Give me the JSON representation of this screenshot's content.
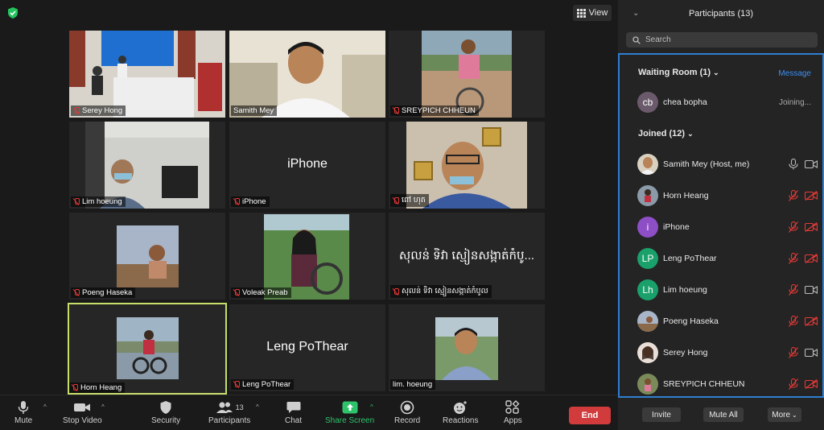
{
  "view_label": "View",
  "tiles": [
    {
      "name": "Serey Hong",
      "muted": true
    },
    {
      "name": "Samith Mey",
      "muted": false
    },
    {
      "name": "SREYPICH CHHEUN",
      "muted": true
    },
    {
      "name": "Lim hoeung",
      "muted": true
    },
    {
      "name": "iPhone",
      "muted": true,
      "big": "iPhone"
    },
    {
      "name": "ពៅ ហុត",
      "muted": true
    },
    {
      "name": "Poeng Haseka",
      "muted": true
    },
    {
      "name": "Voleak Preab",
      "muted": true
    },
    {
      "name": "សុលន់ ទិវា ស្មៀនសង្កាត់កំបូល",
      "muted": true,
      "big": "សុលន់ ទិវា ស្មៀនសង្កាត់កំបូ..."
    },
    {
      "name": "Horn Heang",
      "muted": true
    },
    {
      "name": "Leng PoThear",
      "muted": true,
      "big": "Leng PoThear"
    },
    {
      "name": "lim. hoeung",
      "muted": false
    }
  ],
  "toolbar": {
    "mute": "Mute",
    "stop_video": "Stop Video",
    "security": "Security",
    "participants": "Participants",
    "participants_count": "13",
    "chat": "Chat",
    "share_screen": "Share Screen",
    "record": "Record",
    "reactions": "Reactions",
    "apps": "Apps",
    "end": "End"
  },
  "panel": {
    "title": "Participants (13)",
    "search_placeholder": "Search",
    "waiting_room": "Waiting Room (1)",
    "message": "Message",
    "waiting": {
      "initials": "cb",
      "name": "chea bopha",
      "status": "Joining...",
      "color": "#6b5a6b"
    },
    "joined": "Joined (12)",
    "participants": [
      {
        "name": "Samith Mey (Host, me)",
        "initials": "",
        "color": "#6b5a4a",
        "mic_on": true,
        "cam_on": true
      },
      {
        "name": "Horn Heang",
        "initials": "",
        "color": "#5a5a6a",
        "mic_on": false,
        "cam_on": false
      },
      {
        "name": "iPhone",
        "initials": "i",
        "color": "#8e4ec6",
        "mic_on": false,
        "cam_on": false
      },
      {
        "name": "Leng PoThear",
        "initials": "LP",
        "color": "#1aa06a",
        "mic_on": false,
        "cam_on": false
      },
      {
        "name": "Lim hoeung",
        "initials": "Lh",
        "color": "#1aa06a",
        "mic_on": false,
        "cam_on": true
      },
      {
        "name": "Poeng Haseka",
        "initials": "",
        "color": "#a06a3a",
        "mic_on": false,
        "cam_on": false
      },
      {
        "name": "Serey Hong",
        "initials": "",
        "color": "#6a4a4a",
        "mic_on": false,
        "cam_on": true
      },
      {
        "name": "SREYPICH CHHEUN",
        "initials": "",
        "color": "#6a7a4a",
        "mic_on": false,
        "cam_on": false
      }
    ],
    "invite": "Invite",
    "mute_all": "Mute All",
    "more": "More"
  }
}
